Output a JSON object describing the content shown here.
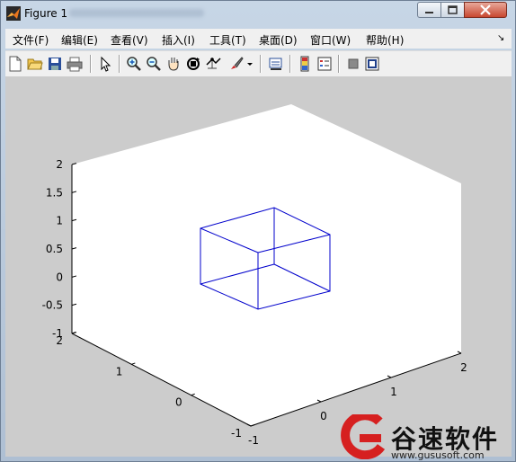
{
  "window": {
    "title": "Figure 1"
  },
  "menu": {
    "items": [
      {
        "label": "文件(F)"
      },
      {
        "label": "编辑(E)"
      },
      {
        "label": "查看(V)"
      },
      {
        "label": "插入(I)"
      },
      {
        "label": "工具(T)"
      },
      {
        "label": "桌面(D)"
      },
      {
        "label": "窗口(W)"
      },
      {
        "label": "帮助(H)"
      }
    ],
    "overflow_icon": "chevron-right-icon"
  },
  "toolbar": {
    "buttons": [
      "new-figure-icon",
      "open-file-icon",
      "save-icon",
      "print-icon",
      "edit-plot-arrow-icon",
      "zoom-in-icon",
      "zoom-out-icon",
      "pan-hand-icon",
      "rotate-3d-icon",
      "data-cursor-icon",
      "brush-icon",
      "link-plot-icon",
      "colorbar-icon",
      "legend-icon",
      "hide-plot-tools-icon",
      "show-plot-tools-icon"
    ]
  },
  "axes": {
    "background": "#ffffff",
    "figure_color": "#cccccc",
    "line_color": "#0000cc",
    "z_ticks": [
      "2",
      "1.5",
      "1",
      "0.5",
      "0",
      "-0.5",
      "-1"
    ],
    "y_ticks": [
      "2",
      "1",
      "0",
      "-1"
    ],
    "x_ticks": [
      "-1",
      "0",
      "1",
      "2"
    ],
    "x_range": [
      -1,
      2
    ],
    "y_range": [
      -1,
      2
    ],
    "z_range": [
      -1,
      2
    ]
  },
  "watermark": {
    "brand": "谷速软件",
    "url": "www.gususoft.com"
  }
}
